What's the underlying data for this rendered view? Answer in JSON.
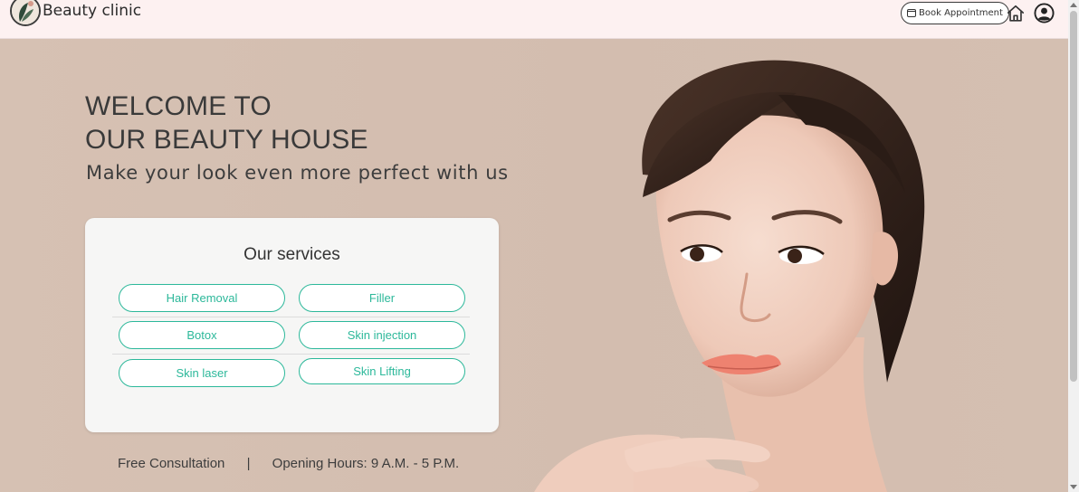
{
  "header": {
    "brand": "Beauty clinic",
    "book_label": "Book Appointment"
  },
  "hero": {
    "welcome_line1": "WELCOME TO",
    "welcome_line2": "OUR BEAUTY HOUSE",
    "tagline": "Make your look even more perfect with us"
  },
  "services": {
    "title": "Our services",
    "items": [
      {
        "label": "Hair Removal"
      },
      {
        "label": "Filler"
      },
      {
        "label": "Botox"
      },
      {
        "label": "Skin injection"
      },
      {
        "label": "Skin laser"
      },
      {
        "label": "Skin Lifting"
      }
    ]
  },
  "footer": {
    "consultation": "Free Consultation",
    "separator": "|",
    "hours": "Opening Hours: 9 A.M. - 5 P.M."
  },
  "colors": {
    "accent": "#2cb89a",
    "header_bg": "#fdf1f1",
    "hero_bg": "#d5bfb0"
  },
  "icons": {
    "logo": "leaf-logo-icon",
    "calendar": "calendar-icon",
    "home": "home-icon",
    "user": "user-icon"
  }
}
